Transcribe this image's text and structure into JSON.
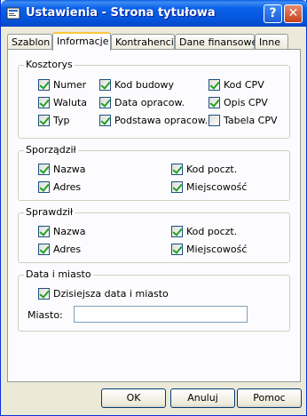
{
  "window": {
    "title": "Ustawienia - Strona tytułowa",
    "help_glyph": "?",
    "close_glyph": "✕"
  },
  "tabs": [
    {
      "label": "Szablon",
      "active": false
    },
    {
      "label": "Informacje",
      "active": true
    },
    {
      "label": "Kontrahenci",
      "active": false
    },
    {
      "label": "Dane finansowe",
      "active": false
    },
    {
      "label": "Inne",
      "active": false
    }
  ],
  "kosztorys": {
    "title": "Kosztorys",
    "items": [
      {
        "label": "Numer",
        "checked": true
      },
      {
        "label": "Kod budowy",
        "checked": true
      },
      {
        "label": "Kod CPV",
        "checked": true
      },
      {
        "label": "Waluta",
        "checked": true
      },
      {
        "label": "Data opracow.",
        "checked": true
      },
      {
        "label": "Opis CPV",
        "checked": true
      },
      {
        "label": "Typ",
        "checked": true
      },
      {
        "label": "Podstawa opracow.",
        "checked": true
      },
      {
        "label": "Tabela CPV",
        "checked": false
      }
    ]
  },
  "sporzadzil": {
    "title": "Sporządził",
    "items": [
      {
        "label": "Nazwa",
        "checked": true
      },
      {
        "label": "Kod poczt.",
        "checked": true
      },
      {
        "label": "Adres",
        "checked": true
      },
      {
        "label": "Miejscowość",
        "checked": true
      }
    ]
  },
  "sprawdzil": {
    "title": "Sprawdził",
    "items": [
      {
        "label": "Nazwa",
        "checked": true
      },
      {
        "label": "Kod poczt.",
        "checked": true
      },
      {
        "label": "Adres",
        "checked": true
      },
      {
        "label": "Miejscowość",
        "checked": true
      }
    ]
  },
  "data_miasto": {
    "title": "Data i miasto",
    "today": {
      "label": "Dzisiejsza data i miasto",
      "checked": true
    },
    "city_label": "Miasto:",
    "city_value": ""
  },
  "buttons": {
    "ok": "OK",
    "cancel": "Anuluj",
    "help": "Pomoc"
  }
}
